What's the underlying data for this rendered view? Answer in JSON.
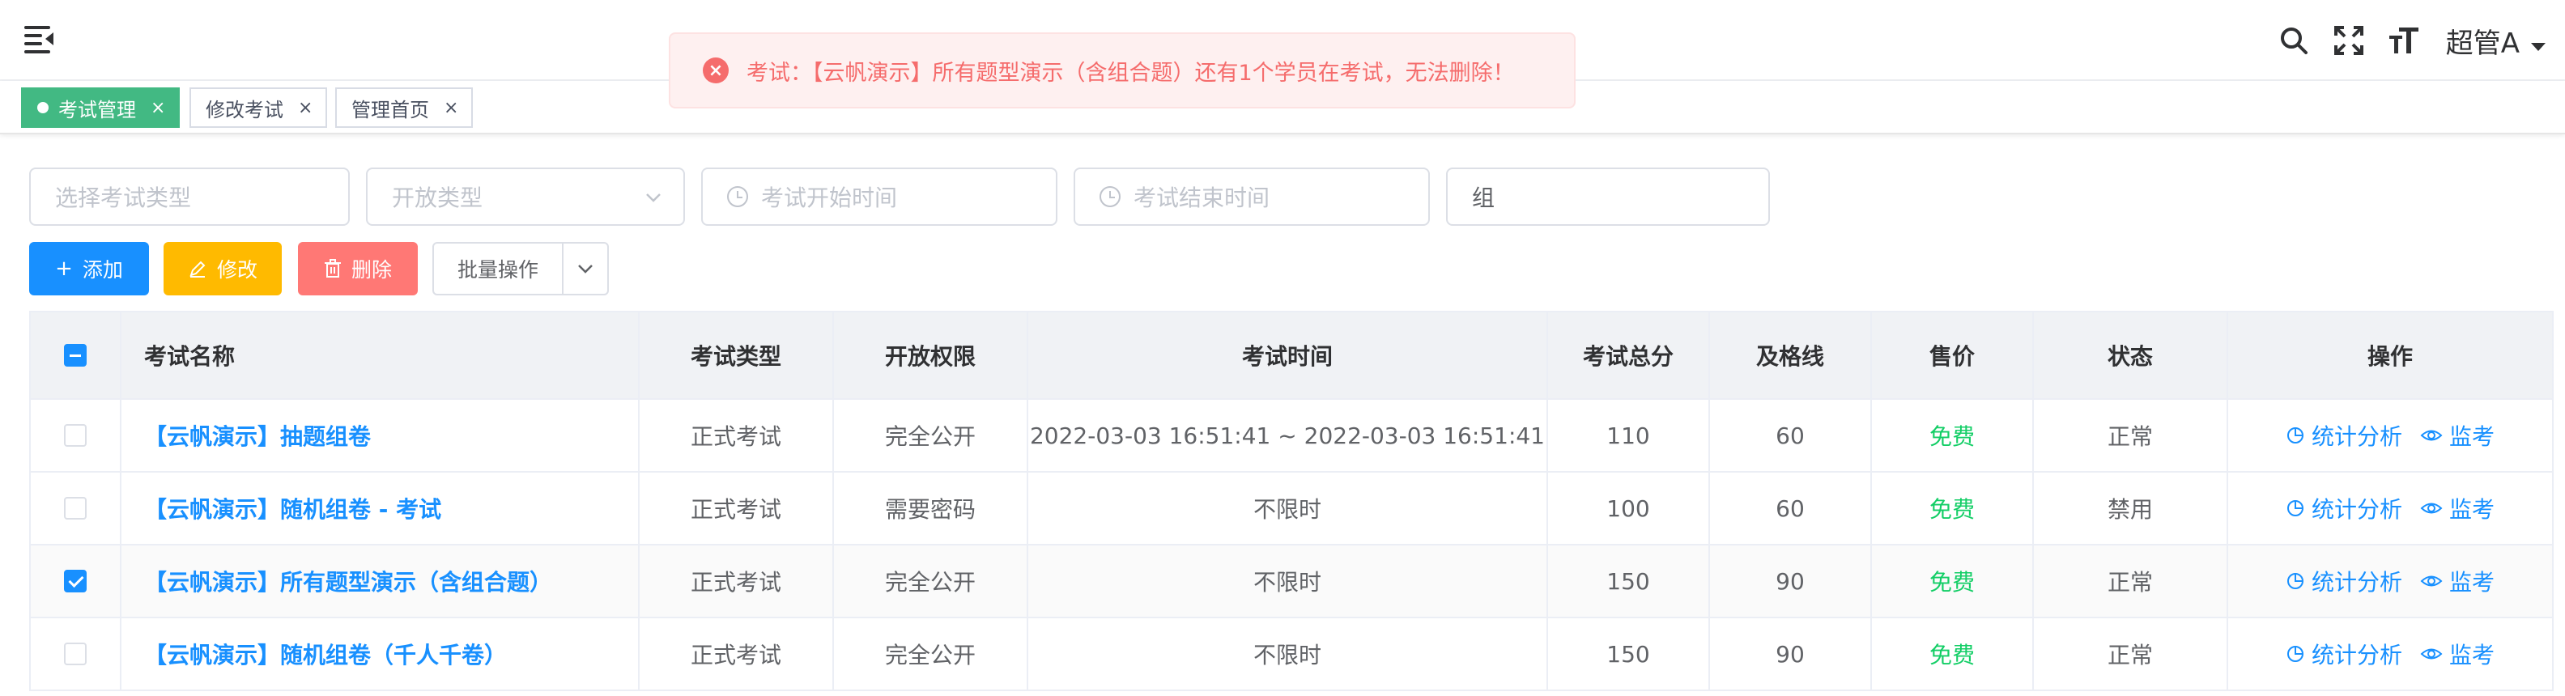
{
  "header": {
    "username": "超管A",
    "icons": [
      "hamburger-icon",
      "search-icon",
      "fullscreen-icon",
      "font-size-icon",
      "caret-down-icon"
    ]
  },
  "tags": [
    {
      "label": "考试管理",
      "close": "×",
      "active": true
    },
    {
      "label": "修改考试",
      "close": "×",
      "active": false
    },
    {
      "label": "管理首页",
      "close": "×",
      "active": false
    }
  ],
  "toast": {
    "message": "考试：【云帆演示】所有题型演示（含组合题）还有1个学员在考试，无法删除！",
    "type": "error",
    "icon": "error-circle-icon"
  },
  "filters": {
    "exam_type_placeholder": "选择考试类型",
    "open_type_placeholder": "开放类型",
    "start_time_placeholder": "考试开始时间",
    "end_time_placeholder": "考试结束时间",
    "keyword_value": "组"
  },
  "toolbar": {
    "add_label": "添加",
    "edit_label": "修改",
    "delete_label": "删除",
    "batch_label": "批量操作"
  },
  "table": {
    "headers": [
      "考试名称",
      "考试类型",
      "开放权限",
      "考试时间",
      "考试总分",
      "及格线",
      "售价",
      "状态",
      "操作"
    ],
    "rows": [
      {
        "checked": false,
        "name": "【云帆演示】抽题组卷",
        "type": "正式考试",
        "open": "完全公开",
        "time": "2022-03-03 16:51:41 ~ 2022-03-03 16:51:41",
        "total": "110",
        "pass": "60",
        "price": "免费",
        "status": "正常",
        "op1": "统计分析",
        "op2": "监考"
      },
      {
        "checked": false,
        "name": "【云帆演示】随机组卷 - 考试",
        "type": "正式考试",
        "open": "需要密码",
        "time": "不限时",
        "total": "100",
        "pass": "60",
        "price": "免费",
        "status": "禁用",
        "op1": "统计分析",
        "op2": "监考"
      },
      {
        "checked": true,
        "name": "【云帆演示】所有题型演示（含组合题）",
        "type": "正式考试",
        "open": "完全公开",
        "time": "不限时",
        "total": "150",
        "pass": "90",
        "price": "免费",
        "status": "正常",
        "op1": "统计分析",
        "op2": "监考"
      },
      {
        "checked": false,
        "name": "【云帆演示】随机组卷（千人千卷）",
        "type": "正式考试",
        "open": "完全公开",
        "time": "不限时",
        "total": "150",
        "pass": "90",
        "price": "免费",
        "status": "正常",
        "op1": "统计分析",
        "op2": "监考"
      }
    ]
  },
  "colors": {
    "primary": "#1890ff",
    "warning": "#ffba00",
    "danger": "#ff7875",
    "success_tag": "#42b983",
    "free_text": "#13ce66",
    "toast_text": "#f56c6c"
  }
}
